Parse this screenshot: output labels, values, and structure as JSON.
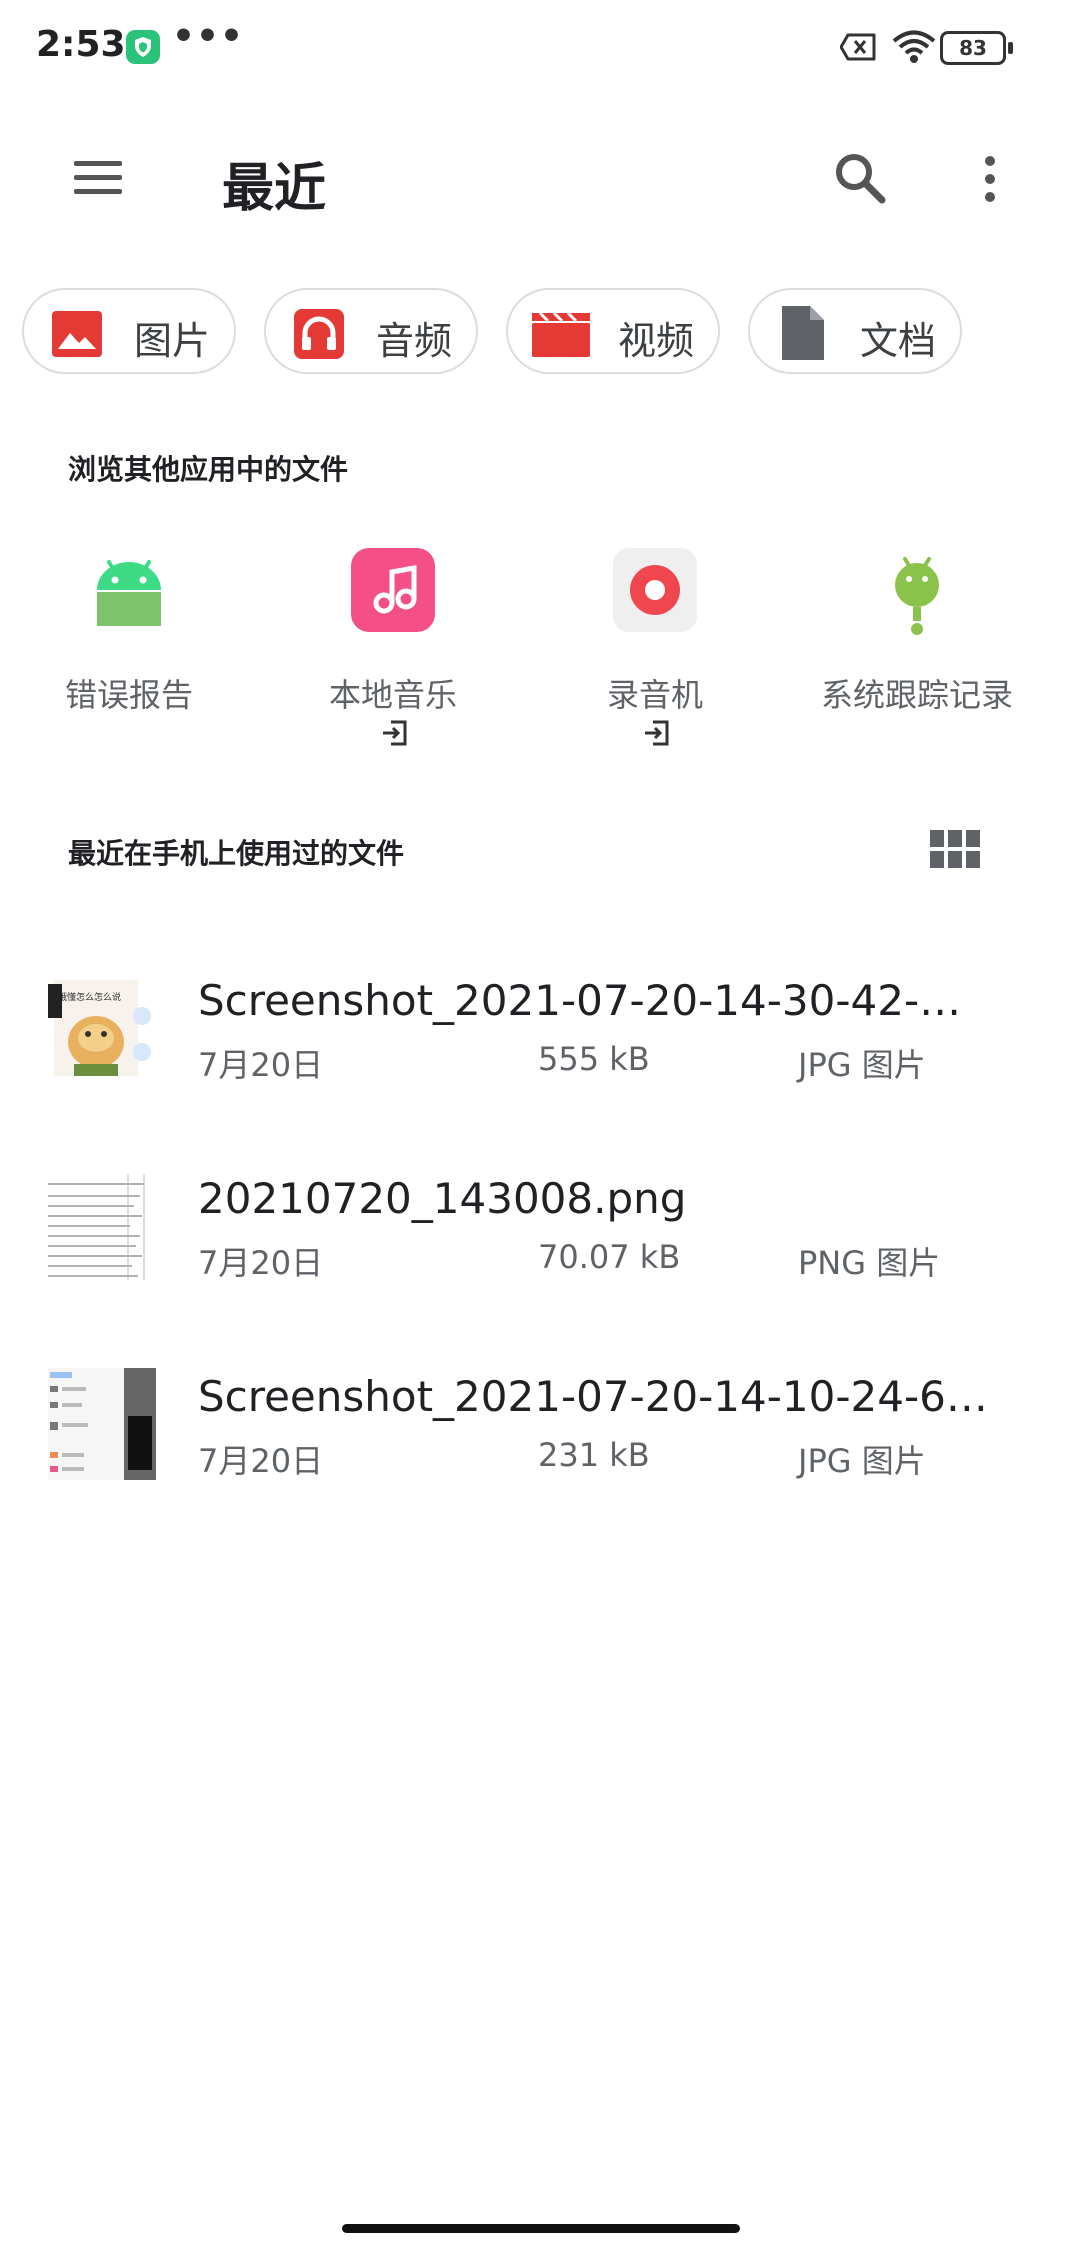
{
  "status_bar": {
    "time": "2:53",
    "overflow": "•••",
    "battery": "83",
    "icons": [
      "shield-icon",
      "notification-off-icon",
      "wifi-icon",
      "battery-icon"
    ]
  },
  "app_bar": {
    "title": "最近",
    "icons": [
      "menu-icon",
      "search-icon",
      "more-vert-icon"
    ]
  },
  "categories": [
    {
      "label": "图片",
      "icon": "image-icon",
      "color": "#e53935"
    },
    {
      "label": "音频",
      "icon": "headphones-icon",
      "color": "#e53935"
    },
    {
      "label": "视频",
      "icon": "video-clapper-icon",
      "color": "#e53935"
    },
    {
      "label": "文档",
      "icon": "document-icon",
      "color": "#5f6368"
    }
  ],
  "other_apps": {
    "title": "浏览其他应用中的文件",
    "items": [
      {
        "label": "错误报告",
        "icon": "android-icon",
        "external": false
      },
      {
        "label": "本地音乐",
        "icon": "music-app-icon",
        "external": true
      },
      {
        "label": "录音机",
        "icon": "recorder-icon",
        "external": true
      },
      {
        "label": "系统跟踪记录",
        "icon": "android-trace-icon",
        "external": false
      }
    ]
  },
  "recent": {
    "title": "最近在手机上使用过的文件",
    "view_toggle_icon": "grid-view-icon",
    "files": [
      {
        "name": "Screenshot_2021-07-20-14-30-42-…",
        "date": "7月20日",
        "size": "555 kB",
        "type": "JPG 图片",
        "thumb_text": "哦懂怎么怎么说"
      },
      {
        "name": "20210720_143008.png",
        "date": "7月20日",
        "size": "70.07 kB",
        "type": "PNG 图片"
      },
      {
        "name": "Screenshot_2021-07-20-14-10-24-6…",
        "date": "7月20日",
        "size": "231 kB",
        "type": "JPG 图片"
      }
    ]
  },
  "colors": {
    "accent_red": "#e53935",
    "music_pink": "#f44f87",
    "android_green": "#3ddc84",
    "text_secondary": "#5f6368"
  }
}
